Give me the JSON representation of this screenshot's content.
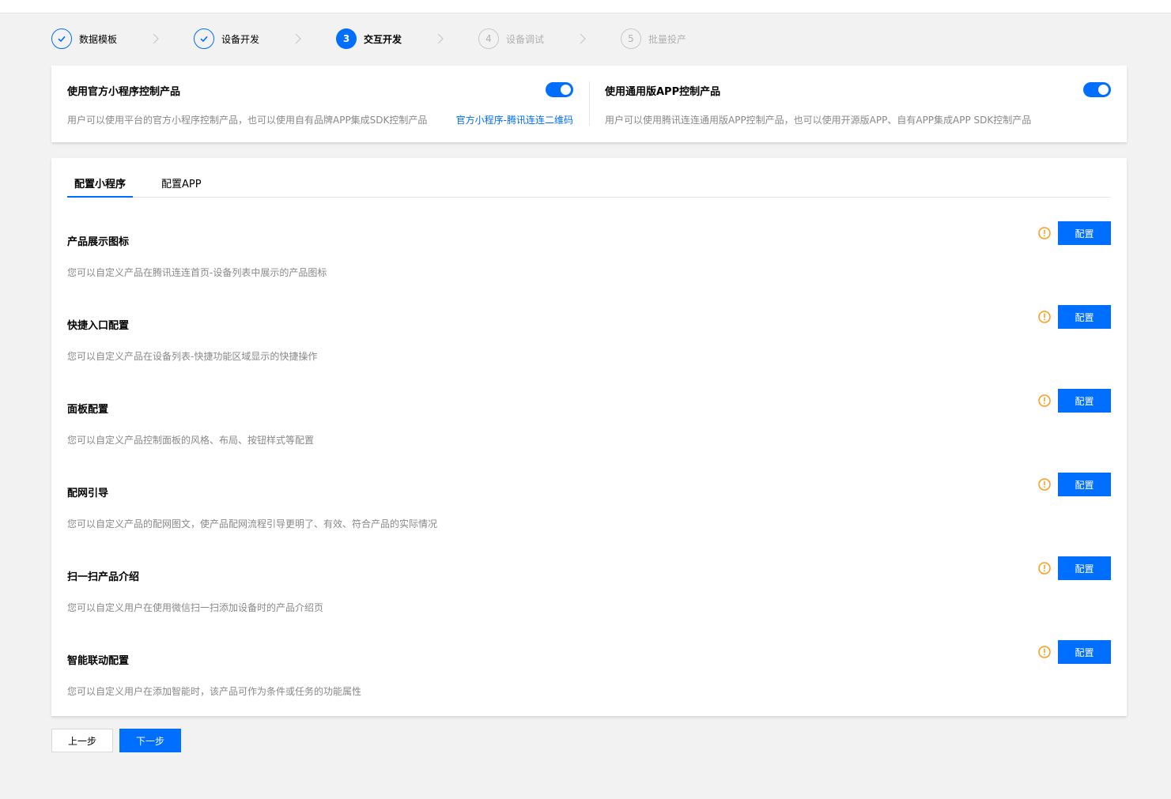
{
  "steps": [
    {
      "number": "1",
      "label": "数据模板",
      "state": "done"
    },
    {
      "number": "2",
      "label": "设备开发",
      "state": "done"
    },
    {
      "number": "3",
      "label": "交互开发",
      "state": "active"
    },
    {
      "number": "4",
      "label": "设备调试",
      "state": "todo"
    },
    {
      "number": "5",
      "label": "批量投产",
      "state": "todo"
    }
  ],
  "mini_program_panel": {
    "title": "使用官方小程序控制产品",
    "description": "用户可以使用平台的官方小程序控制产品，也可以使用自有品牌APP集成SDK控制产品",
    "link": "官方小程序-腾讯连连二维码",
    "enabled": true
  },
  "app_panel": {
    "title": "使用通用版APP控制产品",
    "description": "用户可以使用腾讯连连通用版APP控制产品，也可以使用开源版APP、自有APP集成APP SDK控制产品",
    "enabled": true
  },
  "tabs": [
    {
      "label": "配置小程序",
      "active": true
    },
    {
      "label": "配置APP",
      "active": false
    }
  ],
  "config_items": [
    {
      "title": "产品展示图标",
      "description": "您可以自定义产品在腾讯连连首页-设备列表中展示的产品图标",
      "button": "配置"
    },
    {
      "title": "快捷入口配置",
      "description": "您可以自定义产品在设备列表-快捷功能区域显示的快捷操作",
      "button": "配置"
    },
    {
      "title": "面板配置",
      "description": "您可以自定义产品控制面板的风格、布局、按钮样式等配置",
      "button": "配置"
    },
    {
      "title": "配网引导",
      "description": "您可以自定义产品的配网图文，使产品配网流程引导更明了、有效、符合产品的实际情况",
      "button": "配置"
    },
    {
      "title": "扫一扫产品介绍",
      "description": "您可以自定义用户在使用微信扫一扫添加设备时的产品介绍页",
      "button": "配置"
    },
    {
      "title": "智能联动配置",
      "description": "您可以自定义用户在添加智能时，该产品可作为条件或任务的功能属性",
      "button": "配置"
    }
  ],
  "footer": {
    "prev_label": "上一步",
    "next_label": "下一步"
  },
  "colors": {
    "accent": "#006eff",
    "warning": "#ff9c19",
    "background": "#f2f2f2"
  }
}
